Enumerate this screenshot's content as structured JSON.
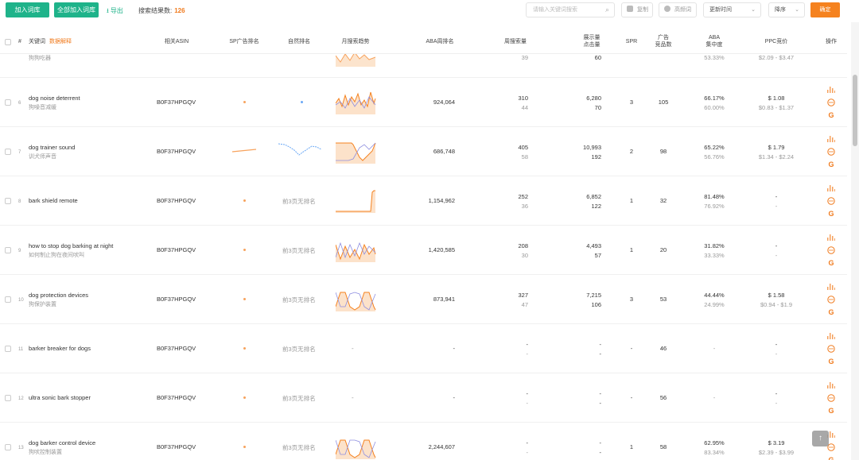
{
  "toolbar": {
    "add_label": "加入词库",
    "add_all_label": "全部加入词库",
    "export_label": "导出",
    "result_count_label": "搜索结果数:",
    "result_count": "126",
    "search_placeholder": "请输入关键词搜索",
    "copy_label": "复制",
    "freq_label": "高频词",
    "sort_field": "更新时间",
    "sort_order": "降序",
    "confirm_label": "确定"
  },
  "headers": {
    "index": "#",
    "keyword": "关键词",
    "keyword_tag": "数据解释",
    "asin": "相关ASIN",
    "sp_rank": "SP广告排名",
    "natural_rank": "自然排名",
    "trend": "月搜索趋势",
    "aba_rank": "ABA周排名",
    "weekly_search": "周搜索量",
    "display_click_1": "展示量",
    "display_click_2": "点击量",
    "spr": "SPR",
    "ad_products_1": "广告",
    "ad_products_2": "竞品数",
    "aba_conc_1": "ABA",
    "aba_conc_2": "集中度",
    "ppc": "PPC竞价",
    "ops": "操作"
  },
  "partial_row": {
    "keyword_cn": "狗狗吃器",
    "weekly_search_2": "39",
    "display_2": "60",
    "aba_conc_2": "53.33%",
    "ppc_range": "$2.09 - $3.47"
  },
  "rows": [
    {
      "index": "6",
      "keyword": "dog noise deterrent",
      "keyword_cn": "狗噪音减缓",
      "asin": "B0F37HPGQV",
      "natural": "",
      "aba_rank": "924,064",
      "ws1": "310",
      "ws2": "44",
      "dc1": "6,280",
      "dc2": "70",
      "spr": "3",
      "ads": "105",
      "pct1": "66.17%",
      "pct2": "60.00%",
      "ppc1": "$ 1.08",
      "ppc2": "$0.83 - $1.37"
    },
    {
      "index": "7",
      "keyword": "dog trainer sound",
      "keyword_cn": "训犬师声音",
      "asin": "B0F37HPGQV",
      "natural": "",
      "aba_rank": "686,748",
      "ws1": "405",
      "ws2": "58",
      "dc1": "10,993",
      "dc2": "192",
      "spr": "2",
      "ads": "98",
      "pct1": "65.22%",
      "pct2": "56.76%",
      "ppc1": "$ 1.79",
      "ppc2": "$1.34 - $2.24"
    },
    {
      "index": "8",
      "keyword": "bark shield remote",
      "keyword_cn": "",
      "asin": "B0F37HPGQV",
      "natural": "前3页无排名",
      "aba_rank": "1,154,962",
      "ws1": "252",
      "ws2": "36",
      "dc1": "6,852",
      "dc2": "122",
      "spr": "1",
      "ads": "32",
      "pct1": "81.48%",
      "pct2": "76.92%",
      "ppc1": "-",
      "ppc2": "-"
    },
    {
      "index": "9",
      "keyword": "how to stop dog barking at night",
      "keyword_cn": "如何制止狗在夜间吠叫",
      "asin": "B0F37HPGQV",
      "natural": "前3页无排名",
      "aba_rank": "1,420,585",
      "ws1": "208",
      "ws2": "30",
      "dc1": "4,493",
      "dc2": "57",
      "spr": "1",
      "ads": "20",
      "pct1": "31.82%",
      "pct2": "33.33%",
      "ppc1": "-",
      "ppc2": "-"
    },
    {
      "index": "10",
      "keyword": "dog protection devices",
      "keyword_cn": "狗保护装置",
      "asin": "B0F37HPGQV",
      "natural": "前3页无排名",
      "aba_rank": "873,941",
      "ws1": "327",
      "ws2": "47",
      "dc1": "7,215",
      "dc2": "106",
      "spr": "3",
      "ads": "53",
      "pct1": "44.44%",
      "pct2": "24.99%",
      "ppc1": "$ 1.58",
      "ppc2": "$0.94 - $1.9"
    },
    {
      "index": "11",
      "keyword": "barker breaker for dogs",
      "keyword_cn": "",
      "asin": "B0F37HPGQV",
      "natural": "前3页无排名",
      "aba_rank": "-",
      "ws1": "-",
      "ws2": "-",
      "dc1": "-",
      "dc2": "-",
      "spr": "-",
      "ads": "46",
      "pct1": "-",
      "pct2": "",
      "ppc1": "-",
      "ppc2": "-"
    },
    {
      "index": "12",
      "keyword": "ultra sonic bark stopper",
      "keyword_cn": "",
      "asin": "B0F37HPGQV",
      "natural": "前3页无排名",
      "aba_rank": "-",
      "ws1": "-",
      "ws2": "-",
      "dc1": "-",
      "dc2": "-",
      "spr": "-",
      "ads": "56",
      "pct1": "-",
      "pct2": "",
      "ppc1": "-",
      "ppc2": "-"
    },
    {
      "index": "13",
      "keyword": "dog barker control device",
      "keyword_cn": "狗吠控制装置",
      "asin": "B0F37HPGQV",
      "natural": "前3页无排名",
      "aba_rank": "2,244,607",
      "ws1": "-",
      "ws2": "-",
      "dc1": "-",
      "dc2": "-",
      "spr": "1",
      "ads": "58",
      "pct1": "62.95%",
      "pct2": "83.34%",
      "ppc1": "$ 3.19",
      "ppc2": "$2.39 - $3.99"
    }
  ],
  "colors": {
    "accent_green": "#1fb38a",
    "accent_orange": "#f5821f"
  }
}
